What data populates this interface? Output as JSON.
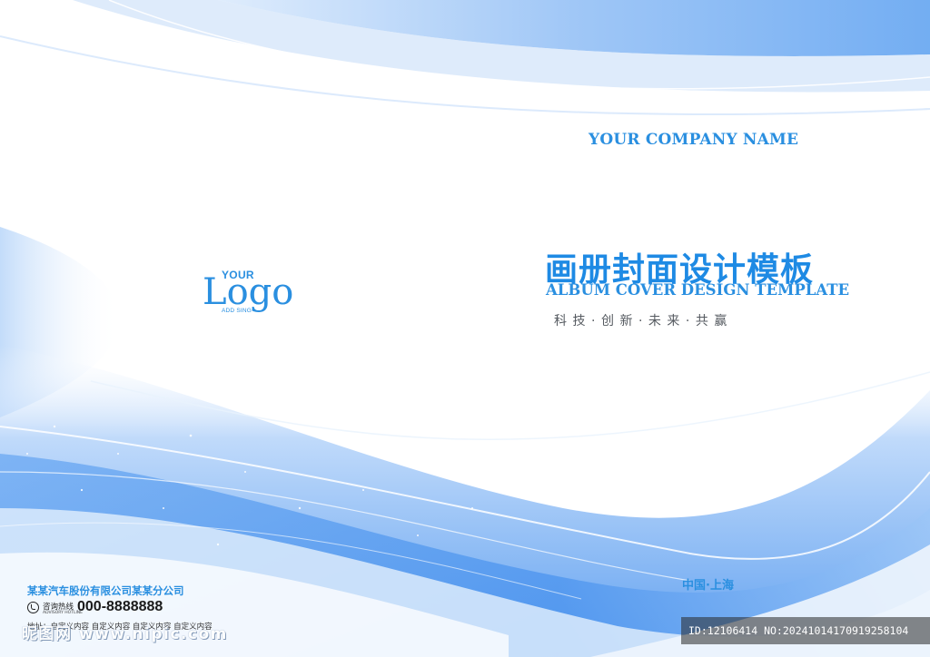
{
  "company": {
    "name": "YOUR COMPANY NAME"
  },
  "title": {
    "cn": "画册封面设计模板",
    "en": "ALBUM COVER DESIGN TEMPLATE",
    "slogan": "科技·创新·未来·共赢"
  },
  "logo": {
    "top": "YOUR",
    "main": "Logo",
    "sub": "ADD SING"
  },
  "location": "中国·上海",
  "footer": {
    "corp_name": "某某汽车股份有限公司某某分公司",
    "hotline_label": "咨询热线",
    "hotline_sub": "ADVISORY HOTLINE",
    "hotline_number": "000-8888888",
    "address": "地址：自定义内容 自定义内容 自定义内容 自定义内容"
  },
  "watermark": {
    "site": "昵图网 www.nipic.com",
    "id_line": "ID:12106414 NO:20241014170919258104"
  },
  "colors": {
    "accent": "#2a8fe0",
    "wave_dark": "#3f8ff0",
    "wave_light": "#cfe3fb"
  },
  "icons": [
    "phone-icon"
  ]
}
